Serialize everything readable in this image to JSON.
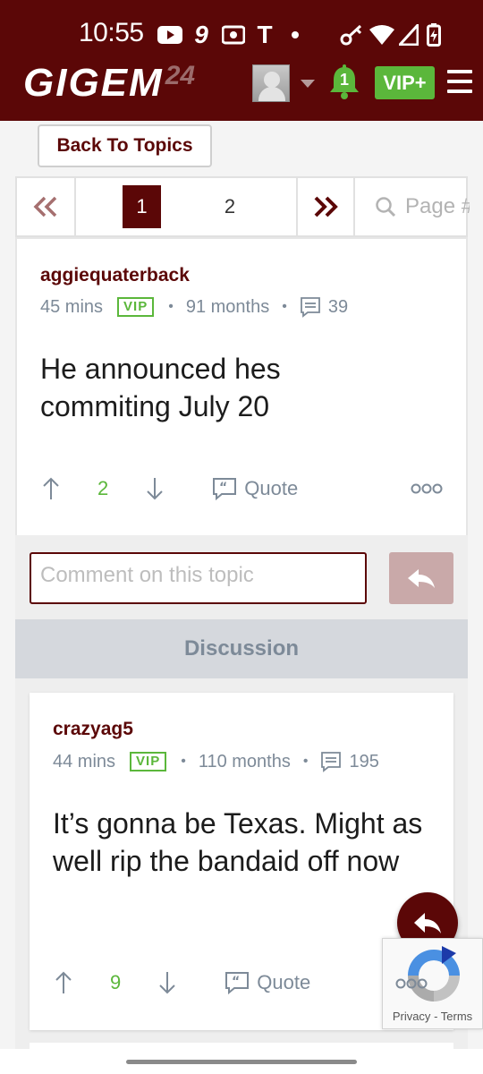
{
  "status_bar": {
    "time": "10:55",
    "icons": [
      "youtube-icon",
      "nine-icon",
      "radio-icon",
      "t-mobile-icon",
      "dot-icon",
      "key-icon",
      "wifi-icon",
      "signal-icon",
      "battery-icon"
    ]
  },
  "header": {
    "logo_text": "GIGEM",
    "logo_number": "24",
    "notification_count": "1",
    "vip_label": "VIP+",
    "colors": {
      "brand": "#5b0707",
      "accent": "#5bb73b"
    }
  },
  "nav": {
    "back_label": "Back To Topics"
  },
  "pager": {
    "prev_label": "«",
    "pages": [
      "1",
      "2"
    ],
    "current_page": "1",
    "next_label": "»",
    "search_placeholder": "Page #"
  },
  "topic_post": {
    "author": "aggiequaterback",
    "time": "45 mins",
    "badge": "VIP",
    "tenure": "91 months",
    "post_count": "39",
    "body": "He announced hes commiting July 20",
    "votes": "2",
    "quote_label": "Quote"
  },
  "comment": {
    "placeholder": "Comment on this topic"
  },
  "discussion": {
    "heading": "Discussion",
    "posts": [
      {
        "author": "crazyag5",
        "time": "44 mins",
        "badge": "VIP",
        "tenure": "110 months",
        "post_count": "195",
        "body": "It’s gonna be Texas. Might as well rip the bandaid off now",
        "votes": "9",
        "quote_label": "Quote"
      }
    ]
  },
  "recaptcha": {
    "privacy": "Privacy",
    "separator": "-",
    "terms": "Terms"
  }
}
